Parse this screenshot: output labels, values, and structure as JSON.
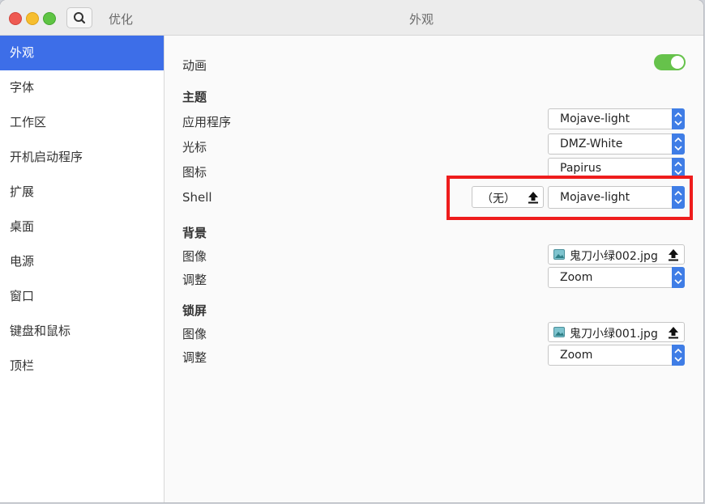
{
  "titlebar": {
    "app_title": "优化",
    "page_title": "外观"
  },
  "sidebar": {
    "items": [
      {
        "label": "外观"
      },
      {
        "label": "字体"
      },
      {
        "label": "工作区"
      },
      {
        "label": "开机启动程序"
      },
      {
        "label": "扩展"
      },
      {
        "label": "桌面"
      },
      {
        "label": "电源"
      },
      {
        "label": "窗口"
      },
      {
        "label": "键盘和鼠标"
      },
      {
        "label": "顶栏"
      }
    ]
  },
  "appearance": {
    "animation_label": "动画",
    "animation_on": true,
    "theme_section": "主题",
    "app_label": "应用程序",
    "app_value": "Mojave-light",
    "cursor_label": "光标",
    "cursor_value": "DMZ-White",
    "icons_label": "图标",
    "icons_value": "Papirus",
    "shell_label": "Shell",
    "shell_none": "（无）",
    "shell_value": "Mojave-light",
    "bg_section": "背景",
    "bg_image_label": "图像",
    "bg_image_value": "鬼刀小绿002.jpg",
    "bg_adjust_label": "调整",
    "bg_adjust_value": "Zoom",
    "lock_section": "锁屏",
    "lock_image_label": "图像",
    "lock_image_value": "鬼刀小绿001.jpg",
    "lock_adjust_label": "调整",
    "lock_adjust_value": "Zoom"
  },
  "colors": {
    "accent": "#3d6ee8",
    "toggle_on": "#66c24b",
    "highlight": "#ee1c1c"
  }
}
